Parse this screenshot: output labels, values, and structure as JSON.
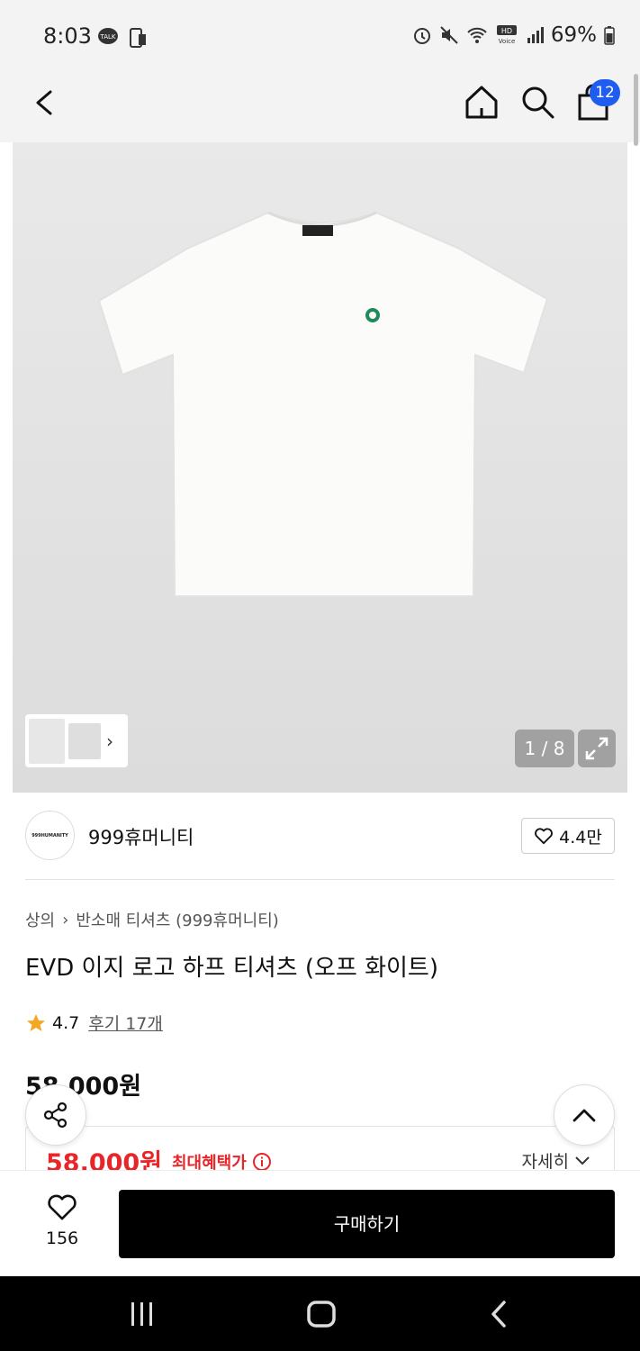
{
  "status_bar": {
    "time": "8:03",
    "battery": "69%",
    "icons": [
      "talk-icon",
      "phone-icon",
      "alarm-icon",
      "mute-icon",
      "wifi-icon",
      "hd-voice-icon",
      "signal-icon",
      "battery-icon"
    ]
  },
  "header": {
    "cart_count": "12"
  },
  "gallery": {
    "counter": "1 / 8"
  },
  "brand": {
    "logo_text": "999HUMANITY",
    "name": "999휴머니티",
    "likes": "4.4만"
  },
  "product": {
    "breadcrumb": [
      "상의",
      "반소매 티셔츠 (999휴머니티)"
    ],
    "title": "EVD 이지 로고 하프 티셔츠 (오프 화이트)",
    "rating": "4.7",
    "reviews": "후기 17개",
    "price": "58,000원"
  },
  "benefit": {
    "price": "58,000원",
    "label": "최대혜택가",
    "detail": "자세히"
  },
  "bottom": {
    "wish_count": "156",
    "buy_label": "구매하기"
  },
  "colors": {
    "accent_red": "#e8262a",
    "badge_blue": "#1f5cf0",
    "buy_black": "#000000"
  }
}
